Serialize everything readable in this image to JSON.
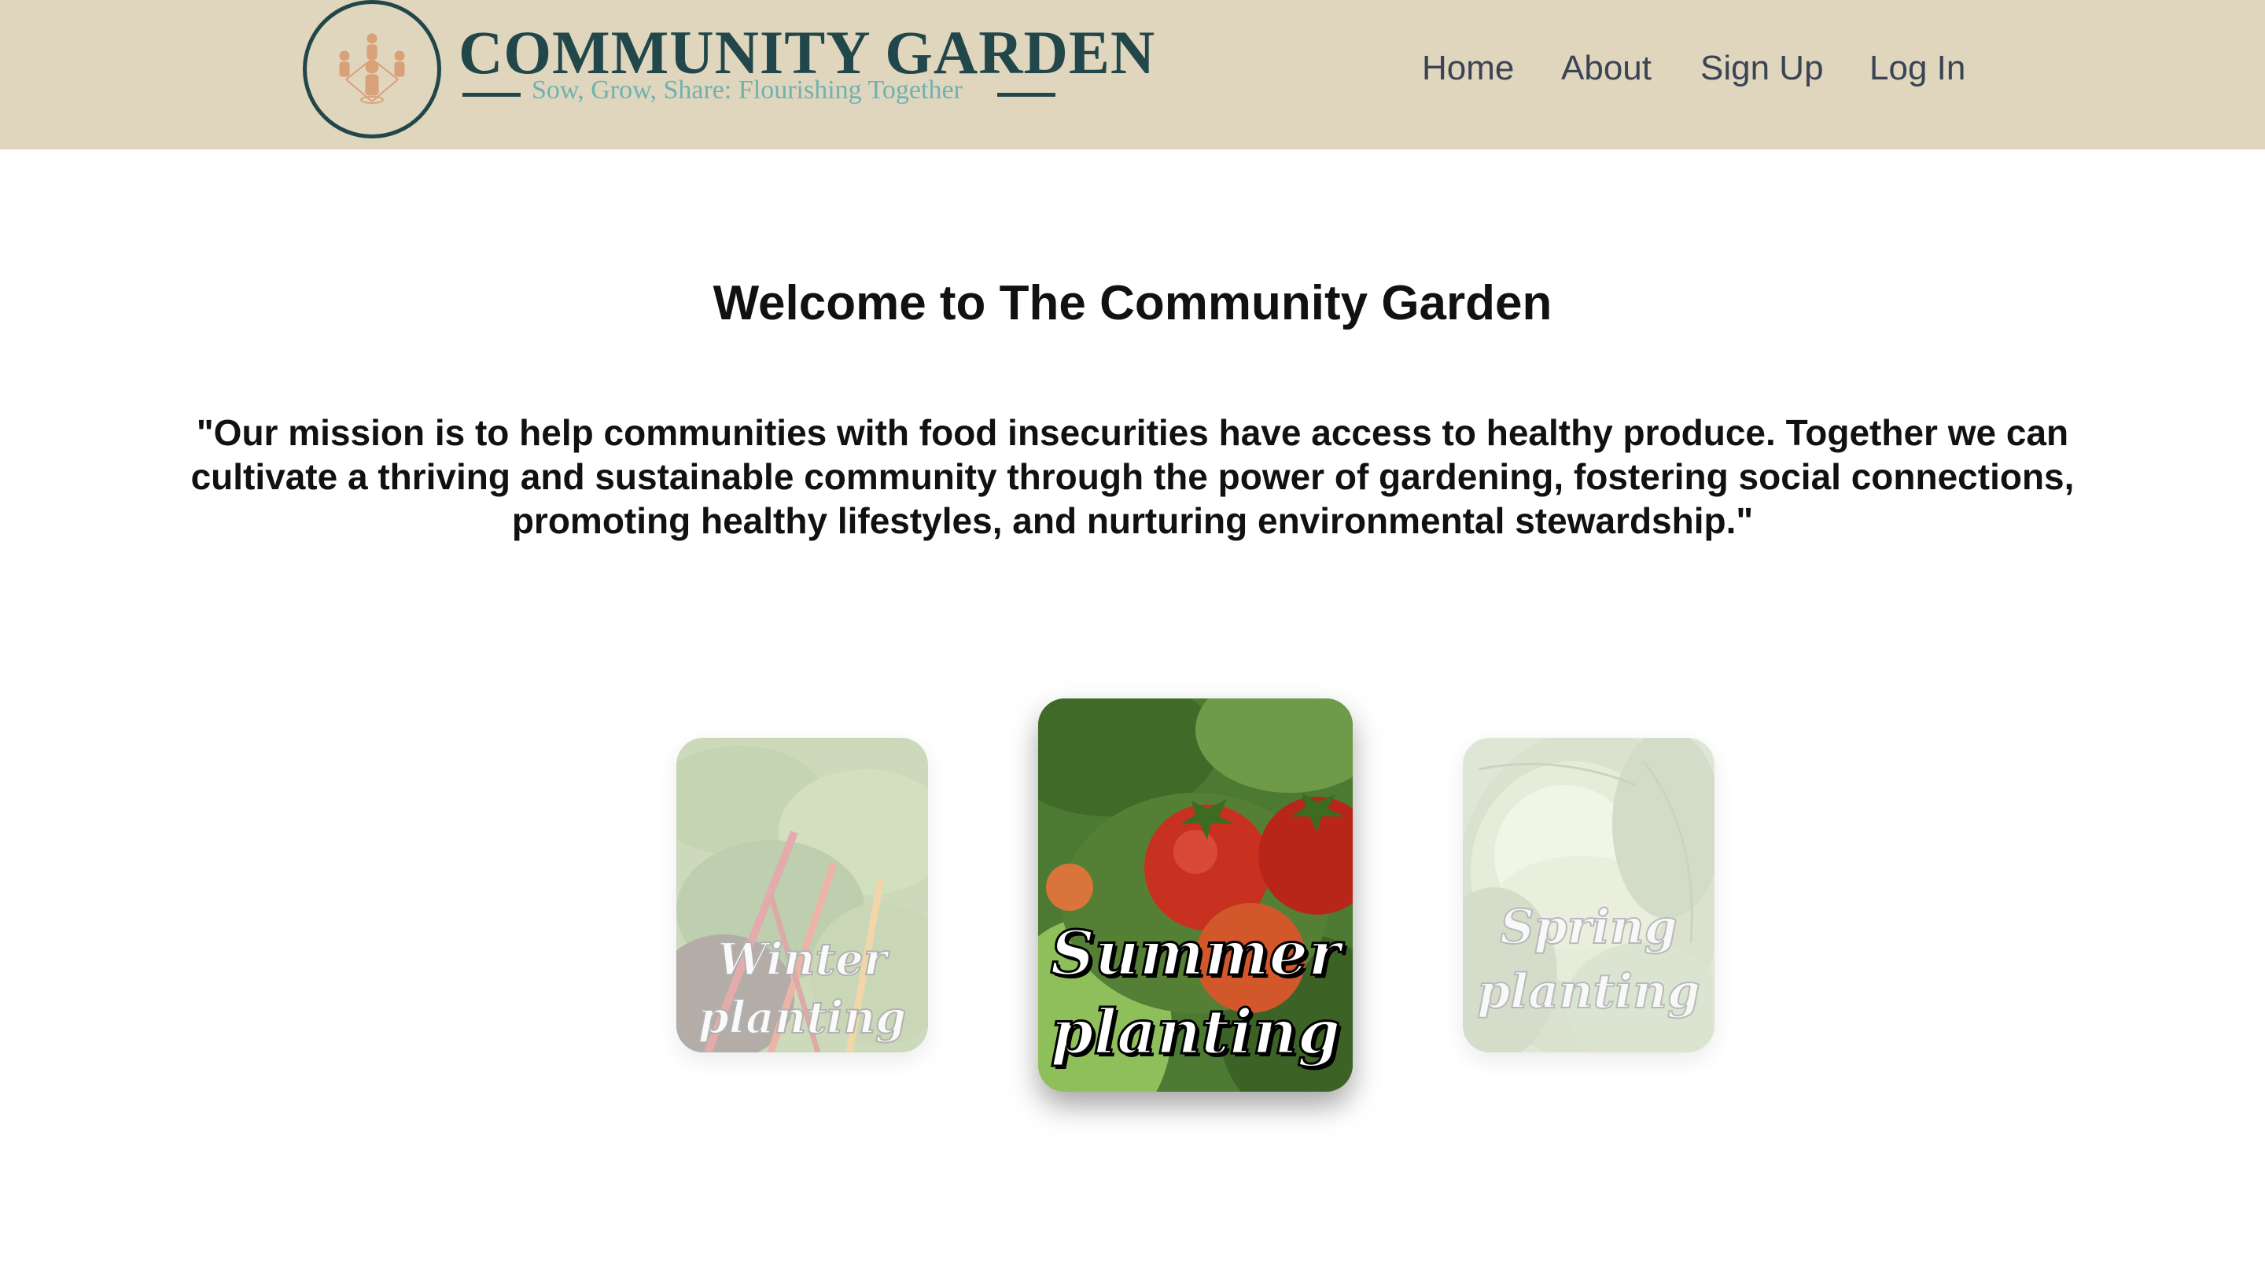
{
  "header": {
    "brand_title": "COMMUNITY GARDEN",
    "brand_tagline": "Sow, Grow, Share: Flourishing Together",
    "logo_icon": "community-people-icon",
    "brand_color": "#21474a",
    "background": "#e0d5bd"
  },
  "nav": {
    "items": [
      {
        "label": "Home"
      },
      {
        "label": "About"
      },
      {
        "label": "Sign Up"
      },
      {
        "label": "Log In"
      }
    ]
  },
  "main": {
    "welcome": "Welcome to The Community Garden",
    "mission": "\"Our mission is to help communities with food insecurities have access to healthy produce. Together we can cultivate a thriving and sustainable community through the power of gardening, fostering social connections, promoting healthy lifestyles, and nurturing environmental stewardship.\""
  },
  "carousel": {
    "cards": [
      {
        "label_line1": "Winter",
        "label_line2": "planting",
        "image": "swiss-chard-image",
        "active": false
      },
      {
        "label_line1": "Summer",
        "label_line2": "planting",
        "image": "tomatoes-image",
        "active": true
      },
      {
        "label_line1": "Spring",
        "label_line2": "planting",
        "image": "cabbage-image",
        "active": false
      }
    ]
  }
}
